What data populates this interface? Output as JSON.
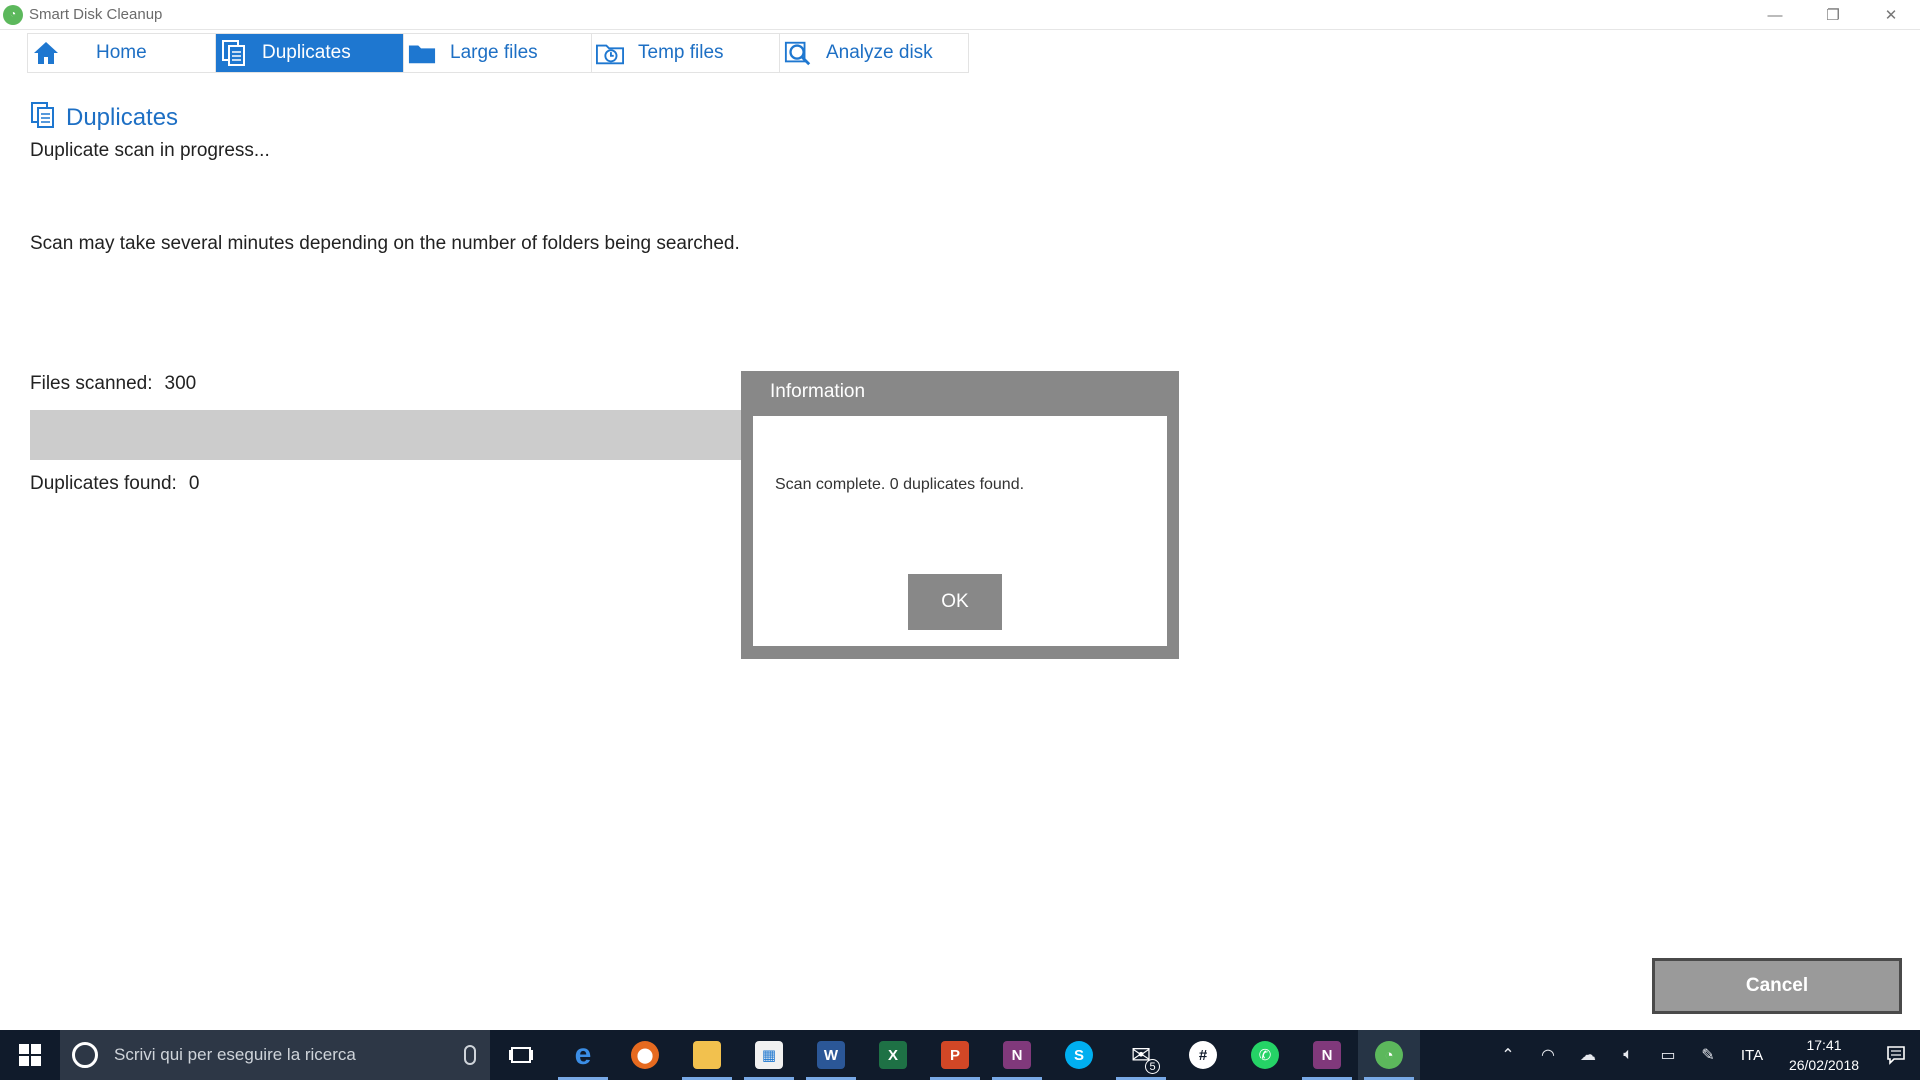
{
  "window": {
    "title": "Smart Disk Cleanup",
    "controls": {
      "minimize": "—",
      "restore": "❐",
      "close": "✕"
    }
  },
  "tabs": [
    {
      "label": "Home",
      "icon": "home-icon",
      "active": false
    },
    {
      "label": "Duplicates",
      "icon": "duplicates-icon",
      "active": true
    },
    {
      "label": "Large files",
      "icon": "folder-icon",
      "active": false
    },
    {
      "label": "Temp files",
      "icon": "temp-files-icon",
      "active": false
    },
    {
      "label": "Analyze disk",
      "icon": "analyze-icon",
      "active": false
    }
  ],
  "main": {
    "section_title": "Duplicates",
    "status": "Duplicate scan in progress...",
    "note": "Scan may take several minutes depending on the number of folders being searched.",
    "files_scanned_label": "Files scanned:",
    "files_scanned_value": "300",
    "duplicates_found_label": "Duplicates found:",
    "duplicates_found_value": "0",
    "cancel_label": "Cancel"
  },
  "dialog": {
    "title": "Information",
    "message": "Scan complete. 0 duplicates found.",
    "ok_label": "OK"
  },
  "taskbar": {
    "search_placeholder": "Scrivi qui per eseguire la ricerca",
    "mail_badge": "5",
    "language": "ITA",
    "time": "17:41",
    "date": "26/02/2018",
    "apps": [
      "task-view-icon",
      "edge-icon",
      "firefox-icon",
      "file-explorer-icon",
      "store-icon",
      "word-icon",
      "excel-icon",
      "powerpoint-icon",
      "onenote-icon",
      "skype-icon",
      "mail-icon",
      "slack-icon",
      "whatsapp-icon",
      "onenote-2-icon",
      "smart-disk-cleanup-icon"
    ]
  },
  "colors": {
    "accent": "#1e77d0",
    "dialog_frame": "#888888",
    "taskbar": "#101b2b"
  }
}
